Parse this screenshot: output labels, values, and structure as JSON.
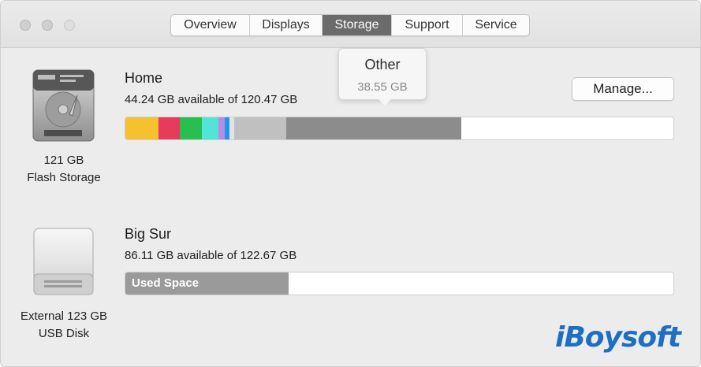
{
  "tabs": [
    {
      "label": "Overview",
      "active": false
    },
    {
      "label": "Displays",
      "active": false
    },
    {
      "label": "Storage",
      "active": true
    },
    {
      "label": "Support",
      "active": false
    },
    {
      "label": "Service",
      "active": false
    }
  ],
  "disks": [
    {
      "icon": "hard-drive-icon",
      "caption_line1": "121 GB",
      "caption_line2": "Flash Storage",
      "volume_name": "Home",
      "available": "44.24 GB available of 120.47 GB",
      "segments": [
        {
          "color": "#f5c12e",
          "fraction": 0.06
        },
        {
          "color": "#e83a5c",
          "fraction": 0.04
        },
        {
          "color": "#27c04e",
          "fraction": 0.04
        },
        {
          "color": "#52e4d6",
          "fraction": 0.03
        },
        {
          "color": "#b68de0",
          "fraction": 0.012
        },
        {
          "color": "#2196e8",
          "fraction": 0.008
        },
        {
          "color": "#e3e3e3",
          "fraction": 0.008
        },
        {
          "color": "#c0c0c0",
          "fraction": 0.095
        },
        {
          "color": "#8c8c8c",
          "fraction": 0.32
        }
      ],
      "tooltip": {
        "title": "Other",
        "value": "38.55 GB"
      }
    },
    {
      "icon": "usb-disk-icon",
      "caption_line1": "External 123 GB",
      "caption_line2": "USB Disk",
      "volume_name": "Big Sur",
      "available": "86.11 GB available of 122.67 GB",
      "used_label": "Used Space",
      "used_fraction": 0.298,
      "used_color": "#9a9a9a"
    }
  ],
  "manage_label": "Manage...",
  "watermark": "iBoysoft",
  "colors": {
    "accent_tab": "#6b6b6b",
    "watermark": "#1d6fc4"
  }
}
